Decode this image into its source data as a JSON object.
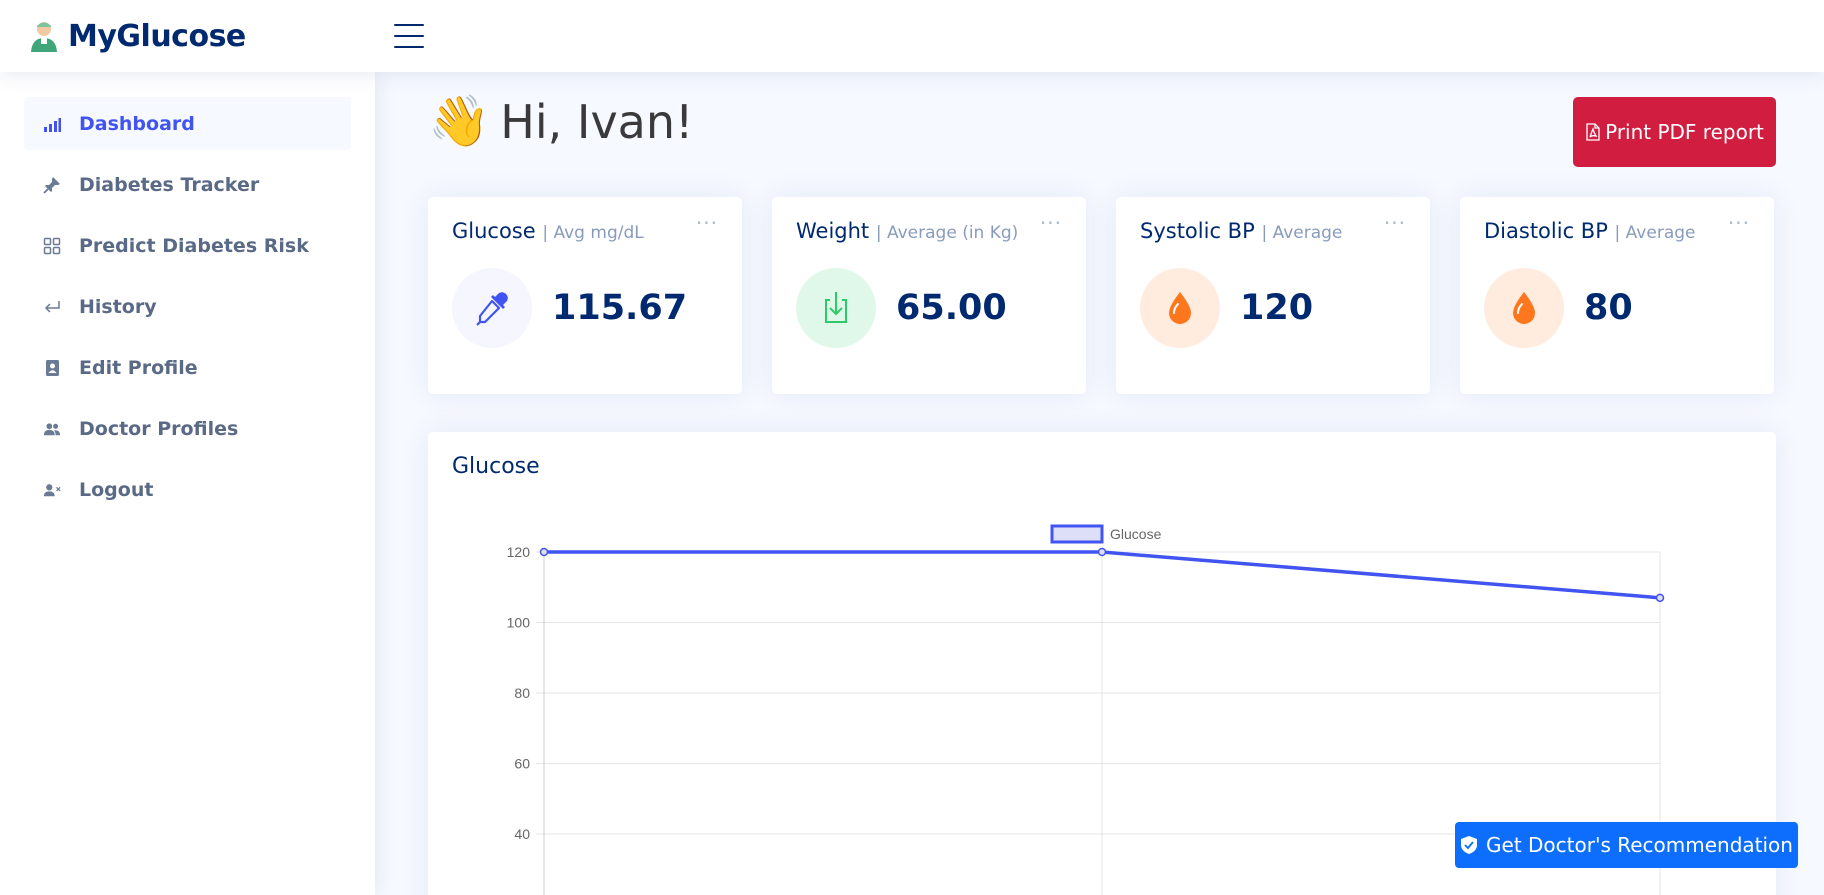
{
  "app": {
    "title": "MyGlucose"
  },
  "sidebar": {
    "items": [
      {
        "label": "Dashboard",
        "icon": "bar-chart-icon",
        "active": true
      },
      {
        "label": "Diabetes Tracker",
        "icon": "pin-icon"
      },
      {
        "label": "Predict Diabetes Risk",
        "icon": "grid-icon"
      },
      {
        "label": "History",
        "icon": "return-arrow-icon"
      },
      {
        "label": "Edit Profile",
        "icon": "contact-card-icon"
      },
      {
        "label": "Doctor Profiles",
        "icon": "people-icon"
      },
      {
        "label": "Logout",
        "icon": "user-remove-icon"
      }
    ]
  },
  "main": {
    "greeting": "Hi, Ivan!",
    "greeting_emoji": "👋",
    "print_button": "Print PDF report",
    "cards": [
      {
        "title": "Glucose",
        "subtitle": "| Avg mg/dL",
        "value": "115.67",
        "icon": "eyedropper-icon",
        "icon_color": "#4154f1",
        "icon_bg": "#f6f6fe"
      },
      {
        "title": "Weight",
        "subtitle": "| Average (in Kg)",
        "value": "65.00",
        "icon": "download-icon",
        "icon_color": "#2eca6a",
        "icon_bg": "#e0f8e9"
      },
      {
        "title": "Systolic BP",
        "subtitle": "| Average",
        "value": "120",
        "icon": "droplet-icon",
        "icon_color": "#ff771d",
        "icon_bg": "#ffecdf"
      },
      {
        "title": "Diastolic BP",
        "subtitle": "| Average",
        "value": "80",
        "icon": "droplet-icon",
        "icon_color": "#ff771d",
        "icon_bg": "#ffecdf"
      }
    ],
    "more_label": "···",
    "chart_card_title": "Glucose"
  },
  "chart_data": {
    "type": "line",
    "categories": [
      "",
      "",
      ""
    ],
    "series": [
      {
        "name": "Glucose",
        "values": [
          120,
          120,
          107
        ],
        "color": "#4154f1"
      }
    ],
    "yticks": [
      120,
      100,
      80,
      60,
      40
    ],
    "ylim": [
      20,
      120
    ],
    "grid": true,
    "legend": "top-center"
  },
  "recommend_button": "Get Doctor's Recommendation",
  "colors": {
    "accent": "#4154f1",
    "danger": "#d11d3f",
    "primary": "#0d6efd",
    "navy": "#012970"
  }
}
